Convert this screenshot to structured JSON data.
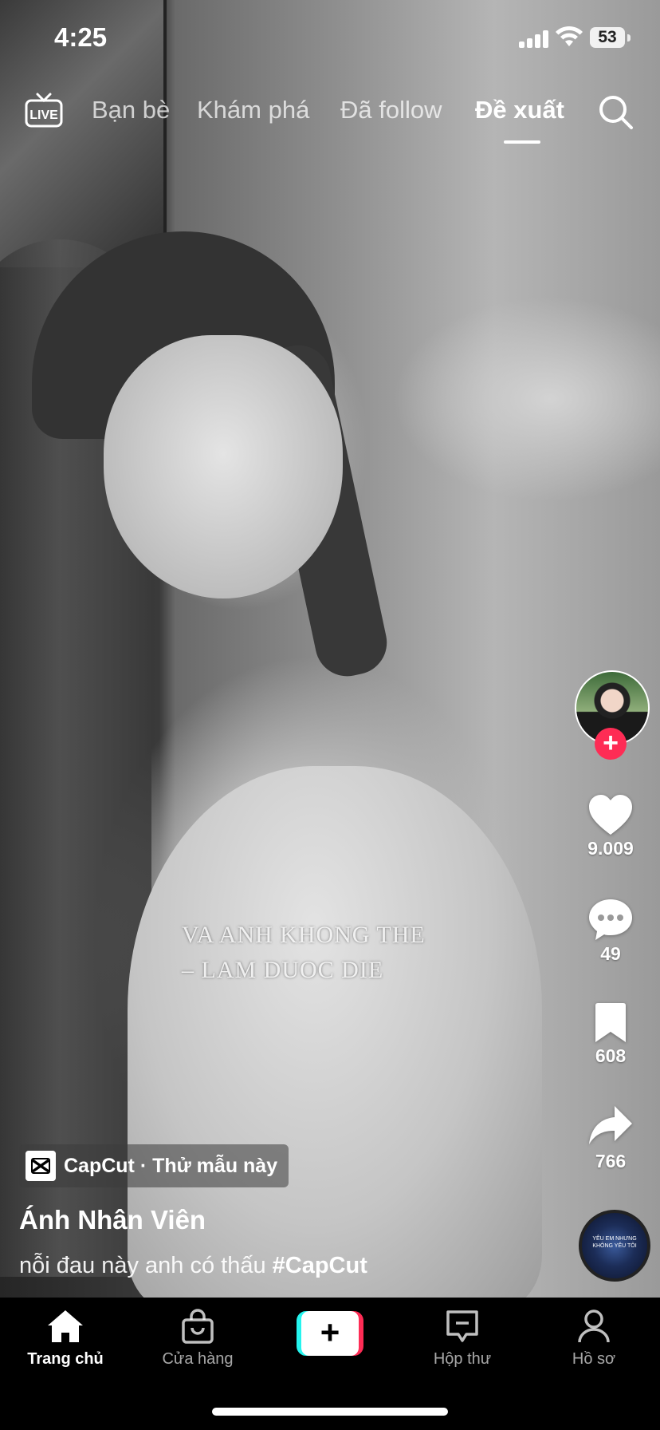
{
  "status_bar": {
    "time": "4:25",
    "battery": "53"
  },
  "top_nav": {
    "live_label": "LIVE",
    "tabs": [
      {
        "label": "Bạn bè",
        "active": false
      },
      {
        "label": "Khám phá",
        "active": false
      },
      {
        "label": "Đã follow",
        "active": false
      },
      {
        "label": "Đề xuất",
        "active": true
      }
    ]
  },
  "video": {
    "overlay_lines": [
      "VA ANH KHONG THE",
      "– LAM DUOC DIE"
    ]
  },
  "actions": {
    "likes": "9.009",
    "comments": "49",
    "saves": "608",
    "shares": "766"
  },
  "music_disc": {
    "text": "YÊU EM NHƯNG KHÔNG YÊU TÔI"
  },
  "post": {
    "template_pill": "CapCut · Thử mẫu này",
    "username": "Ánh Nhân Viên",
    "caption_text": "nỗi đau này anh có thấu ",
    "caption_hashtag": "#CapCut"
  },
  "bottom_nav": {
    "items": [
      {
        "label": "Trang chủ",
        "icon": "home-icon",
        "active": true
      },
      {
        "label": "Cửa hàng",
        "icon": "shop-bag-icon",
        "active": false
      },
      {
        "label": "Hộp thư",
        "icon": "inbox-icon",
        "active": false
      },
      {
        "label": "Hồ sơ",
        "icon": "profile-icon",
        "active": false
      }
    ]
  },
  "colors": {
    "accent": "#fe2c55",
    "cyan": "#25f4ee",
    "nav_bg": "#000000"
  }
}
